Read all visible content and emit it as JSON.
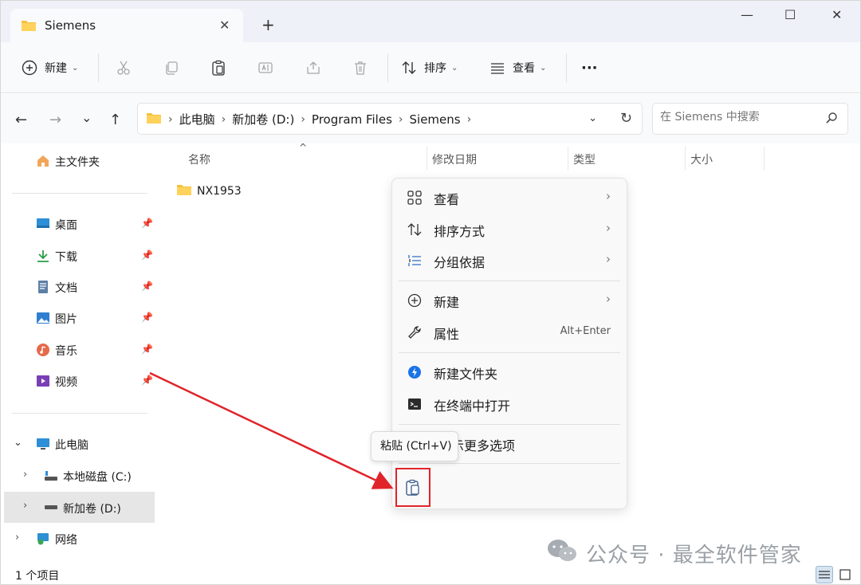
{
  "window": {
    "tab_title": "Siemens",
    "new_tab": "+",
    "minimize": "—",
    "maximize": "☐",
    "close": "✕"
  },
  "toolbar": {
    "new_label": "新建",
    "sort_label": "排序",
    "view_label": "查看",
    "more_label": "···"
  },
  "address": {
    "crumbs": [
      "此电脑",
      "新加卷 (D:)",
      "Program Files",
      "Siemens"
    ],
    "search_placeholder": "在 Siemens 中搜索"
  },
  "sidebar": {
    "home": "主文件夹",
    "quick": [
      {
        "label": "桌面",
        "icon": "desktop-icon"
      },
      {
        "label": "下载",
        "icon": "download-icon"
      },
      {
        "label": "文档",
        "icon": "document-icon"
      },
      {
        "label": "图片",
        "icon": "pictures-icon"
      },
      {
        "label": "音乐",
        "icon": "music-icon"
      },
      {
        "label": "视频",
        "icon": "video-icon"
      }
    ],
    "this_pc": "此电脑",
    "drive_c": "本地磁盘 (C:)",
    "drive_d": "新加卷 (D:)",
    "network": "网络"
  },
  "columns": {
    "name": "名称",
    "modified": "修改日期",
    "type": "类型",
    "size": "大小"
  },
  "files": [
    {
      "name": "NX1953"
    }
  ],
  "context_menu": {
    "view": "查看",
    "sort_by": "排序方式",
    "group_by": "分组依据",
    "new": "新建",
    "properties": "属性",
    "properties_shortcut": "Alt+Enter",
    "new_folder": "新建文件夹",
    "open_terminal": "在终端中打开",
    "more_options": "示更多选项"
  },
  "tooltip": {
    "paste": "粘贴 (Ctrl+V)"
  },
  "status": {
    "item_count": "1 个项目"
  },
  "watermark": {
    "text": "公众号 · 最全软件管家"
  },
  "colors": {
    "annotation_red": "#e0242a",
    "folder_yellow": "#f5c140",
    "accent_blue": "#1a73e8"
  }
}
